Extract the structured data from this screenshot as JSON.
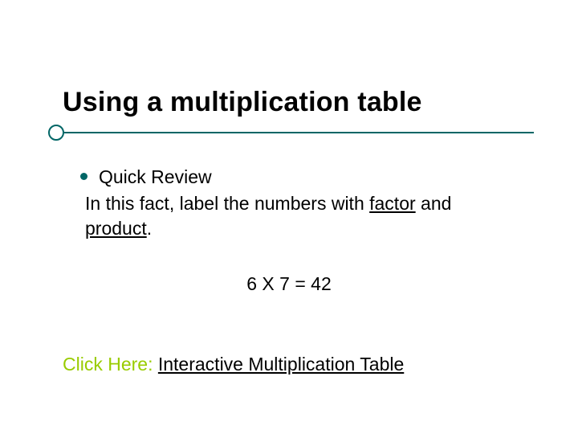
{
  "title": "Using a multiplication table",
  "bullet": {
    "lead": "Quick Review",
    "line2_pre": "In this fact, label the numbers with ",
    "line2_u1": "factor",
    "line2_mid": " and ",
    "line3_u2": "product",
    "line3_post": "."
  },
  "equation": "6 X 7 = 42",
  "link": {
    "prefix": "Click Here: ",
    "text": "Interactive Multiplication Table"
  }
}
